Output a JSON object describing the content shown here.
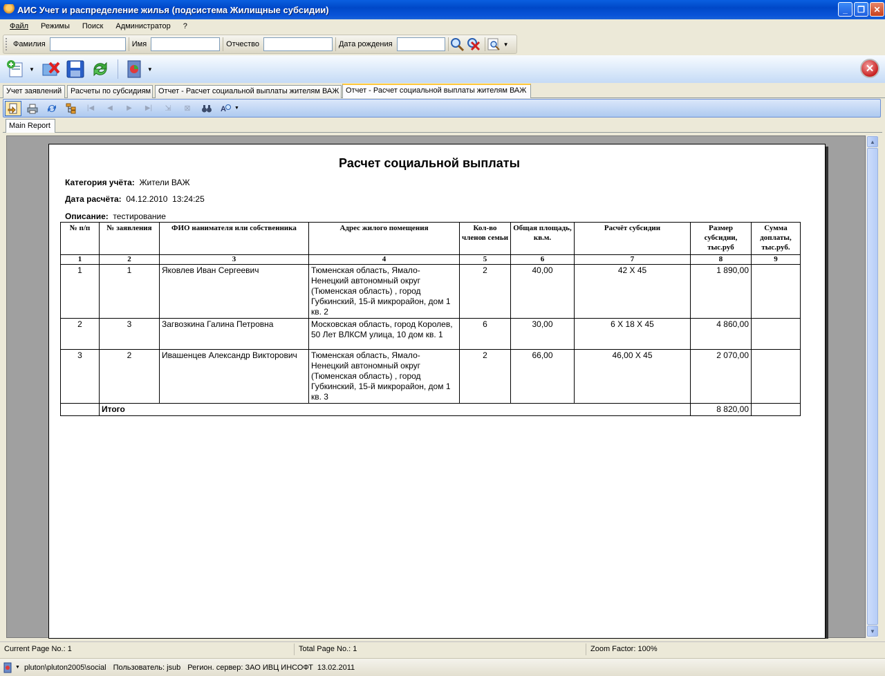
{
  "window": {
    "title": "АИС Учет и распределение жилья (подсистема Жилищные субсидии)",
    "btn_minimize": "_",
    "btn_maximize": "❐",
    "btn_close": "✕"
  },
  "menu": [
    "Файл",
    "Режимы",
    "Поиск",
    "Администратор",
    "?"
  ],
  "search": {
    "lastname_label": "Фамилия",
    "firstname_label": "Имя",
    "patronymic_label": "Отчество",
    "birthdate_label": "Дата рождения",
    "lastname_value": "",
    "firstname_value": "",
    "patronymic_value": "",
    "birthdate_value": ""
  },
  "doc_tabs": [
    "Учет заявлений",
    "Расчеты по субсидиям",
    "Отчет - Расчет социальной выплаты жителям ВАЖ",
    "Отчет - Расчет социальной выплаты жителям ВАЖ"
  ],
  "report_tab": "Main Report",
  "report": {
    "title": "Расчет социальной выплаты",
    "category_label": "Категория учёта:",
    "category_value": "Жители ВАЖ",
    "date_label": "Дата расчёта:",
    "date_value": "04.12.2010  13:24:25",
    "description_label": "Описание:",
    "description_value": "тестирование",
    "headers": [
      "№ п/п",
      "№ заявления",
      "ФИО нанимателя или собственника",
      "Адрес жилого помещения",
      "Кол-во членов семьи",
      "Общая площадь, кв.м.",
      "Расчёт субсидии",
      "Размер субсидии, тыс.руб",
      "Сумма доплаты, тыс.руб."
    ],
    "column_numbers": [
      "1",
      "2",
      "3",
      "4",
      "5",
      "6",
      "7",
      "8",
      "9"
    ],
    "rows": [
      {
        "num": "1",
        "app_no": "1",
        "name": "Яковлев Иван Сергеевич",
        "address": "Тюменская область, Ямало-Ненецкий автономный округ (Тюменская область) , город Губкинский, 15-й микрорайон, дом 1 кв. 2",
        "family": "2",
        "area": "40,00",
        "calc": "42 X 45",
        "subsidy": "1 890,00",
        "extra": ""
      },
      {
        "num": "2",
        "app_no": "3",
        "name": "Загвозкина Галина Петровна",
        "address": "Московская область, город Королев, 50 Лет ВЛКСМ улица, 10 дом кв. 1",
        "family": "6",
        "area": "30,00",
        "calc": "6 X 18 X 45",
        "subsidy": "4 860,00",
        "extra": ""
      },
      {
        "num": "3",
        "app_no": "2",
        "name": "Ивашенцев Александр Викторович",
        "address": "Тюменская область, Ямало-Ненецкий автономный округ (Тюменская область) , город Губкинский, 15-й микрорайон, дом 1 кв. 3",
        "family": "2",
        "area": "66,00",
        "calc": "46,00 X 45",
        "subsidy": "2 070,00",
        "extra": ""
      }
    ],
    "total_label": "Итого",
    "total_value": "8 820,00"
  },
  "status": {
    "current_page": "Current Page No.: 1",
    "total_page": "Total Page No.: 1",
    "zoom": "Zoom Factor: 100%"
  },
  "taskbar": {
    "server_path": "pluton\\pluton2005\\social",
    "user": "Пользователь: jsub",
    "region": "Регион. сервер: ЗАО ИВЦ ИНСОФТ",
    "date": "13.02.2011"
  },
  "icons": {
    "accent": "#316ac5",
    "title_bar": "#0a54d8"
  }
}
